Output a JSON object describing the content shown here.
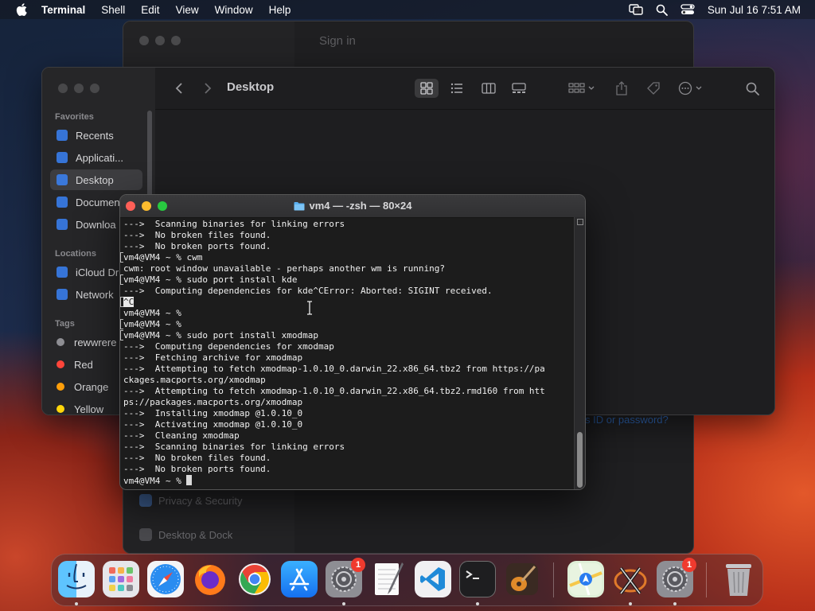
{
  "menubar": {
    "app_name": "Terminal",
    "items": [
      "Shell",
      "Edit",
      "View",
      "Window",
      "Help"
    ],
    "clock": "Sun Jul 16  7:51 AM"
  },
  "settings_window": {
    "signin_text": "Sign in",
    "link_text": "s ID or password?",
    "pane_items": [
      "Privacy & Security",
      "Desktop & Dock"
    ]
  },
  "finder": {
    "title": "Desktop",
    "favorites_header": "Favorites",
    "favorites": [
      "Recents",
      "Applicati...",
      "Desktop",
      "Documen",
      "Downloa"
    ],
    "locations_header": "Locations",
    "locations": [
      "iCloud Dr",
      "Network"
    ],
    "tags_header": "Tags",
    "tags": [
      {
        "label": "rewwrere",
        "color": "#8e8e93"
      },
      {
        "label": "Red",
        "color": "#ff453a"
      },
      {
        "label": "Orange",
        "color": "#ff9f0a"
      },
      {
        "label": "Yellow",
        "color": "#ffd60a"
      }
    ]
  },
  "terminal": {
    "title": "vm4 — -zsh — 80×24",
    "lines": [
      "--->  Scanning binaries for linking errors",
      "--->  No broken files found.",
      "--->  No broken ports found.",
      "vm4@VM4 ~ % cwm",
      "cwm: root window unavailable - perhaps another wm is running?",
      "vm4@VM4 ~ % sudo port install kde",
      "--->  Computing dependencies for kde^CError: Aborted: SIGINT received.",
      "^C",
      "vm4@VM4 ~ % ",
      "vm4@VM4 ~ % ",
      "vm4@VM4 ~ % sudo port install xmodmap",
      "--->  Computing dependencies for xmodmap",
      "--->  Fetching archive for xmodmap",
      "--->  Attempting to fetch xmodmap-1.0.10_0.darwin_22.x86_64.tbz2 from https://pa",
      "ckages.macports.org/xmodmap",
      "--->  Attempting to fetch xmodmap-1.0.10_0.darwin_22.x86_64.tbz2.rmd160 from htt",
      "ps://packages.macports.org/xmodmap",
      "--->  Installing xmodmap @1.0.10_0",
      "--->  Activating xmodmap @1.0.10_0",
      "--->  Cleaning xmodmap",
      "--->  Scanning binaries for linking errors",
      "--->  No broken files found.",
      "--->  No broken ports found.",
      "vm4@VM4 ~ % "
    ]
  },
  "dock": {
    "settings_badge": "1",
    "settings2_badge": "1"
  }
}
